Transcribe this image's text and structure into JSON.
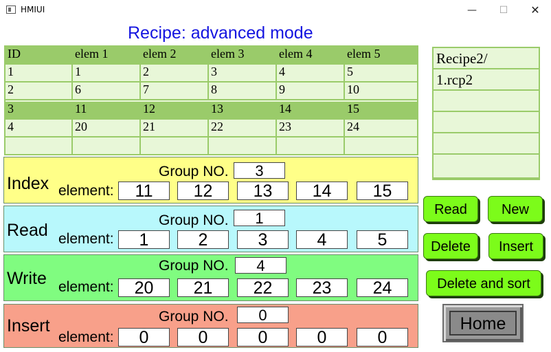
{
  "window": {
    "title": "HMIUI",
    "minimize": "—",
    "maximize": "☐",
    "close": "✕"
  },
  "page_title": "Recipe: advanced mode",
  "table": {
    "rows": [
      [
        "ID",
        "elem 1",
        "elem 2",
        "elem 3",
        "elem 4",
        "elem 5"
      ],
      [
        "1",
        "1",
        "2",
        "3",
        "4",
        "5"
      ],
      [
        "2",
        "6",
        "7",
        "8",
        "9",
        "10"
      ],
      [
        "3",
        "11",
        "12",
        "13",
        "14",
        "15"
      ],
      [
        "4",
        "20",
        "21",
        "22",
        "23",
        "24"
      ],
      [
        "",
        "",
        "",
        "",
        "",
        ""
      ]
    ]
  },
  "file_list": {
    "items": [
      "Recipe2/",
      "1.rcp2",
      "",
      "",
      "",
      ""
    ]
  },
  "panels": {
    "index": {
      "label": "Index",
      "group_label": "Group NO.",
      "group_value": "3",
      "element_label": "element:",
      "elements": [
        "11",
        "12",
        "13",
        "14",
        "15"
      ],
      "color": "#ffff88"
    },
    "read": {
      "label": "Read",
      "group_label": "Group NO.",
      "group_value": "1",
      "element_label": "element:",
      "elements": [
        "1",
        "2",
        "3",
        "4",
        "5"
      ],
      "color": "#b8f8fc"
    },
    "write": {
      "label": "Write",
      "group_label": "Group NO.",
      "group_value": "4",
      "element_label": "element:",
      "elements": [
        "20",
        "21",
        "22",
        "23",
        "24"
      ],
      "color": "#80fc80"
    },
    "insert": {
      "label": "Insert",
      "group_label": "Group NO.",
      "group_value": "0",
      "element_label": "element:",
      "elements": [
        "0",
        "0",
        "0",
        "0",
        "0"
      ],
      "color": "#f8a08a"
    }
  },
  "buttons": {
    "read": "Read",
    "new": "New",
    "delete": "Delete",
    "insert": "Insert",
    "delete_sort": "Delete and sort",
    "home": "Home"
  },
  "colors": {
    "title_blue": "#1515e0",
    "table_green": "#9acb6a",
    "table_light": "#e8f7d8",
    "button_green": "#7cfc1a"
  }
}
